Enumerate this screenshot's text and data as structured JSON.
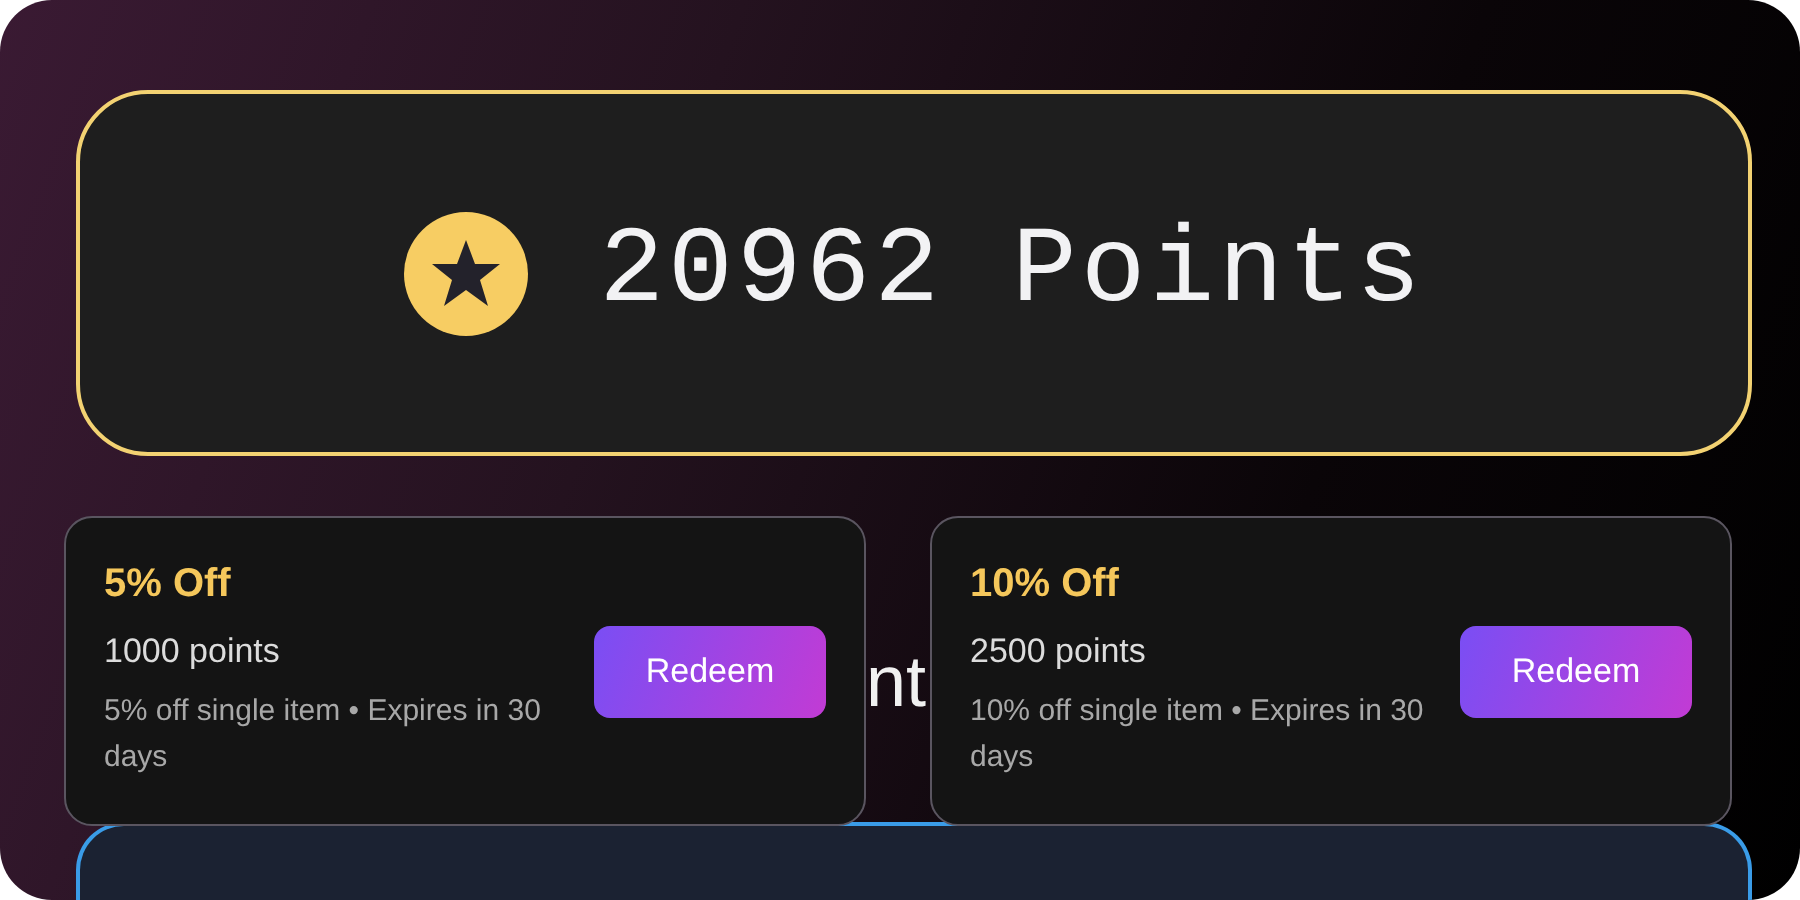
{
  "points_banner": {
    "value": "20962 Points"
  },
  "hidden_heading": "nt",
  "rewards": [
    {
      "title": "5% Off",
      "cost": "1000 points",
      "description": "5% off single item • Expires in 30 days",
      "button": "Redeem"
    },
    {
      "title": "10% Off",
      "cost": "2500 points",
      "description": "10% off single item • Expires in 30 days",
      "button": "Redeem"
    }
  ],
  "lower_panel": {
    "kind": "panel"
  }
}
